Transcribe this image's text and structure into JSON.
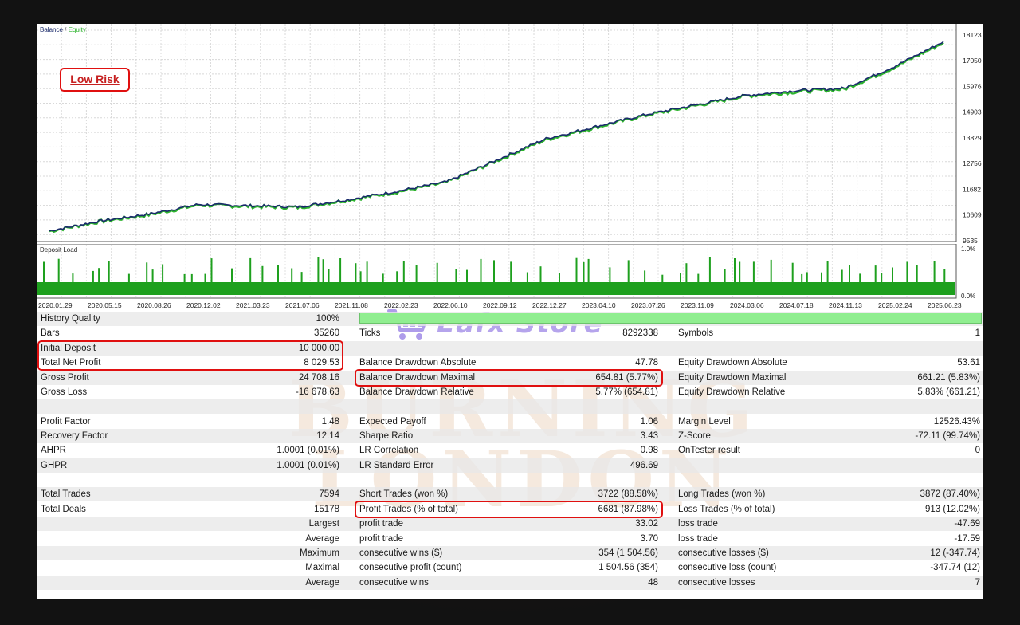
{
  "chart": {
    "legend": "Balance / Equity",
    "balance_color": "#1a2a6c",
    "equity_color": "#2db42d",
    "y_ticks": [
      "18123",
      "17050",
      "15976",
      "14903",
      "13829",
      "12756",
      "11682",
      "10609",
      "9535"
    ],
    "ylim": [
      9535,
      18123
    ]
  },
  "annotation": {
    "label": "Low Risk"
  },
  "deposit_load": {
    "title": "Deposit Load",
    "y_ticks": [
      "1.0%",
      "0.0%"
    ],
    "color": "#1ea01e"
  },
  "x_ticks": [
    "2020.01.29",
    "2020.05.15",
    "2020.08.26",
    "2020.12.02",
    "2021.03.23",
    "2021.07.06",
    "2021.11.08",
    "2022.02.23",
    "2022.06.10",
    "2022.09.12",
    "2022.12.27",
    "2023.04.10",
    "2023.07.26",
    "2023.11.09",
    "2024.03.06",
    "2024.07.18",
    "2024.11.13",
    "2025.02.24",
    "2025.06.23"
  ],
  "chart_data": {
    "type": "line",
    "title": "",
    "x": [
      "2020.01.29",
      "2020.05.15",
      "2020.08.26",
      "2020.12.02",
      "2021.03.23",
      "2021.07.06",
      "2021.11.08",
      "2022.02.23",
      "2022.06.10",
      "2022.09.12",
      "2022.12.27",
      "2023.04.10",
      "2023.07.26",
      "2023.11.09",
      "2024.03.06",
      "2024.07.18",
      "2024.11.13",
      "2025.02.24",
      "2025.06.23"
    ],
    "series": [
      {
        "name": "Balance",
        "values": [
          9950,
          10350,
          10650,
          11050,
          11000,
          10950,
          11250,
          11600,
          12000,
          12900,
          13800,
          14300,
          14800,
          15200,
          15600,
          15800,
          15900,
          16800,
          17850
        ]
      },
      {
        "name": "Equity",
        "values": [
          9930,
          10330,
          10620,
          11020,
          10970,
          10920,
          11230,
          11570,
          11970,
          12870,
          13760,
          14270,
          14760,
          15170,
          15570,
          15750,
          15860,
          16760,
          17800
        ]
      }
    ],
    "ylim": [
      9535,
      18123
    ],
    "grid": true,
    "legend": "top-left"
  },
  "watermark": {
    "title_line1": "BURNING",
    "title_line2": "LONDON",
    "brand": "Eafx Store"
  },
  "stats": {
    "history_quality": {
      "label": "History Quality",
      "value": "100%",
      "fill": 1.0
    },
    "bars": {
      "label": "Bars",
      "value": "35260"
    },
    "ticks": {
      "label": "Ticks",
      "value": "8292338"
    },
    "symbols": {
      "label": "Symbols",
      "value": "1"
    },
    "initial_deposit": {
      "label": "Initial Deposit",
      "value": "10 000.00"
    },
    "total_net_profit": {
      "label": "Total Net Profit",
      "value": "8 029.53"
    },
    "balance_dd_abs": {
      "label": "Balance Drawdown Absolute",
      "value": "47.78"
    },
    "equity_dd_abs": {
      "label": "Equity Drawdown Absolute",
      "value": "53.61"
    },
    "gross_profit": {
      "label": "Gross Profit",
      "value": "24 708.16"
    },
    "balance_dd_max": {
      "label": "Balance Drawdown Maximal",
      "value": "654.81 (5.77%)"
    },
    "equity_dd_max": {
      "label": "Equity Drawdown Maximal",
      "value": "661.21 (5.83%)"
    },
    "gross_loss": {
      "label": "Gross Loss",
      "value": "-16 678.63"
    },
    "balance_dd_rel": {
      "label": "Balance Drawdown Relative",
      "value": "5.77% (654.81)"
    },
    "equity_dd_rel": {
      "label": "Equity Drawdown Relative",
      "value": "5.83% (661.21)"
    },
    "profit_factor": {
      "label": "Profit Factor",
      "value": "1.48"
    },
    "expected_payoff": {
      "label": "Expected Payoff",
      "value": "1.06"
    },
    "margin_level": {
      "label": "Margin Level",
      "value": "12526.43%"
    },
    "recovery_factor": {
      "label": "Recovery Factor",
      "value": "12.14"
    },
    "sharpe_ratio": {
      "label": "Sharpe Ratio",
      "value": "3.43"
    },
    "z_score": {
      "label": "Z-Score",
      "value": "-72.11 (99.74%)"
    },
    "ahpr": {
      "label": "AHPR",
      "value": "1.0001 (0.01%)"
    },
    "lr_correlation": {
      "label": "LR Correlation",
      "value": "0.98"
    },
    "ontester": {
      "label": "OnTester result",
      "value": "0"
    },
    "ghpr": {
      "label": "GHPR",
      "value": "1.0001 (0.01%)"
    },
    "lr_std_error": {
      "label": "LR Standard Error",
      "value": "496.69"
    },
    "total_trades": {
      "label": "Total Trades",
      "value": "7594"
    },
    "short_trades": {
      "label": "Short Trades (won %)",
      "value": "3722 (88.58%)"
    },
    "long_trades": {
      "label": "Long Trades (won %)",
      "value": "3872 (87.40%)"
    },
    "total_deals": {
      "label": "Total Deals",
      "value": "15178"
    },
    "profit_trades": {
      "label": "Profit Trades (% of total)",
      "value": "6681 (87.98%)"
    },
    "loss_trades": {
      "label": "Loss Trades (% of total)",
      "value": "913 (12.02%)"
    },
    "largest": {
      "label": "Largest",
      "profit_label": "profit trade",
      "profit_value": "33.02",
      "loss_label": "loss trade",
      "loss_value": "-47.69"
    },
    "average": {
      "label": "Average",
      "profit_label": "profit trade",
      "profit_value": "3.70",
      "loss_label": "loss trade",
      "loss_value": "-17.59"
    },
    "maximum": {
      "label": "Maximum",
      "profit_label": "consecutive wins ($)",
      "profit_value": "354 (1 504.56)",
      "loss_label": "consecutive losses ($)",
      "loss_value": "12 (-347.74)"
    },
    "maximal": {
      "label": "Maximal",
      "profit_label": "consecutive profit (count)",
      "profit_value": "1 504.56 (354)",
      "loss_label": "consecutive loss (count)",
      "loss_value": "-347.74 (12)"
    },
    "average_consec": {
      "label": "Average",
      "profit_label": "consecutive wins",
      "profit_value": "48",
      "loss_label": "consecutive losses",
      "loss_value": "7"
    }
  }
}
